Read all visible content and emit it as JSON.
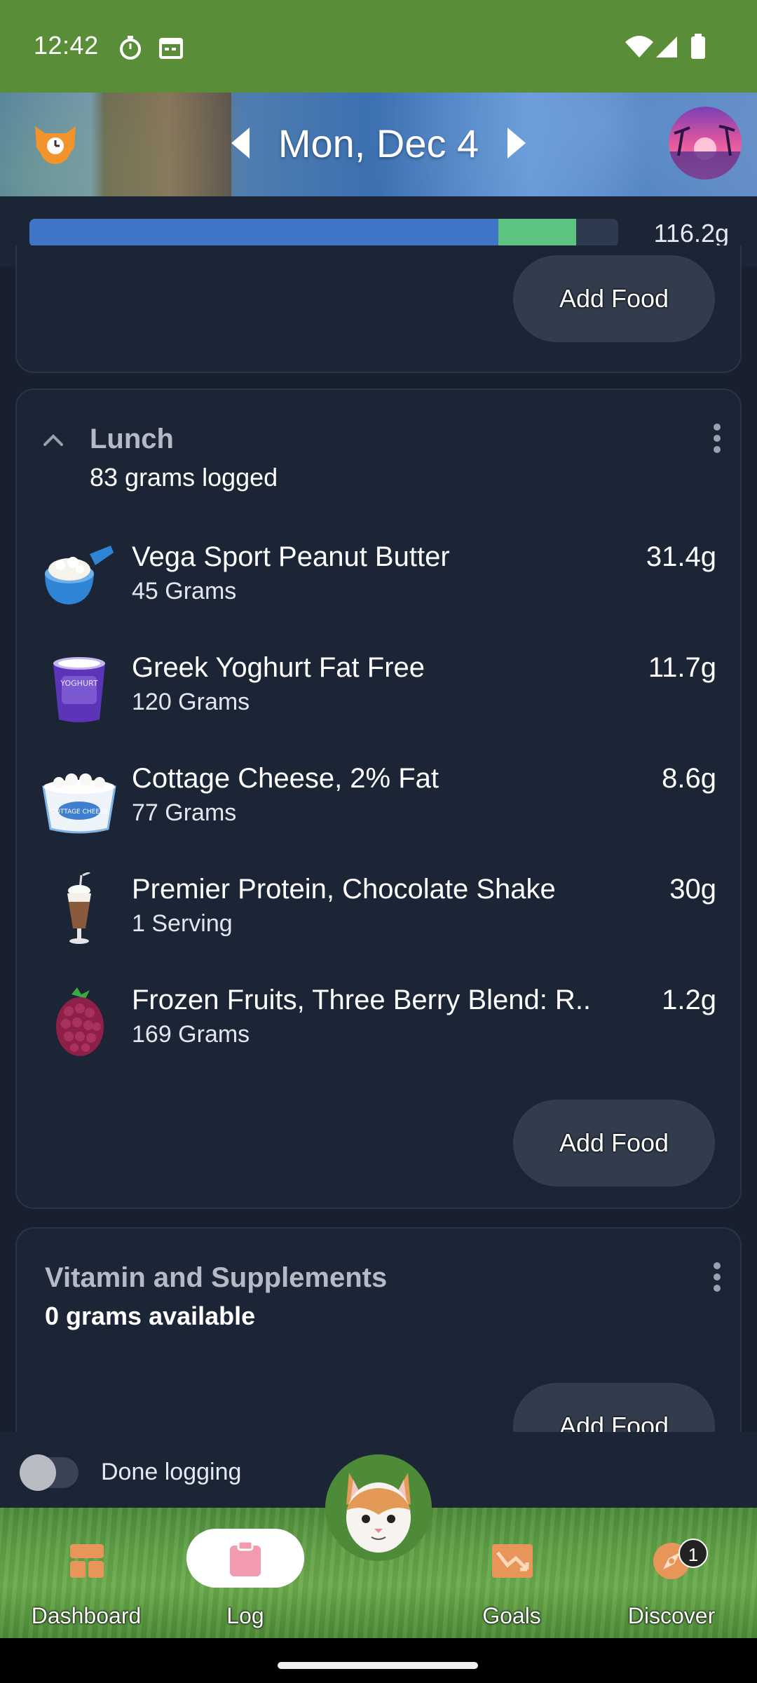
{
  "status_bar": {
    "time": "12:42"
  },
  "header": {
    "date": "Mon, Dec 4"
  },
  "progress": {
    "total_label": "116.2g",
    "protein_fraction": 0.796,
    "extra_fraction": 0.132,
    "colors": {
      "primary": "#3f74c6",
      "secondary": "#5cc480",
      "track": "#2e3a50"
    }
  },
  "previous_meal": {
    "add_food_label": "Add Food"
  },
  "lunch": {
    "title": "Lunch",
    "subtitle": "83 grams logged",
    "add_food_label": "Add Food",
    "items": [
      {
        "name": "Vega Sport Peanut Butter",
        "amount": "45 Grams",
        "value": "31.4g",
        "icon": "scoop-icon"
      },
      {
        "name": "Greek Yoghurt Fat Free",
        "amount": "120 Grams",
        "value": "11.7g",
        "icon": "yoghurt-cup-icon"
      },
      {
        "name": "Cottage Cheese, 2% Fat",
        "amount": "77 Grams",
        "value": "8.6g",
        "icon": "cottage-cheese-icon"
      },
      {
        "name": "Premier Protein, Chocolate Shake",
        "amount": "1 Serving",
        "value": "30g",
        "icon": "milkshake-icon"
      },
      {
        "name": "Frozen Fruits, Three Berry Blend: R..",
        "amount": "169 Grams",
        "value": "1.2g",
        "icon": "berry-icon"
      }
    ]
  },
  "supplements": {
    "title": "Vitamin and Supplements",
    "subtitle": "0 grams available",
    "add_food_label": "Add Food"
  },
  "done_logging": {
    "label": "Done logging",
    "checked": false
  },
  "bottom_nav": {
    "items": [
      {
        "label": "Dashboard",
        "icon": "dashboard-icon",
        "active": false
      },
      {
        "label": "Log",
        "icon": "clipboard-icon",
        "active": true
      },
      {
        "label": "Goals",
        "icon": "goals-chart-icon",
        "active": false
      },
      {
        "label": "Discover",
        "icon": "compass-icon",
        "active": false,
        "badge": "1"
      }
    ]
  }
}
